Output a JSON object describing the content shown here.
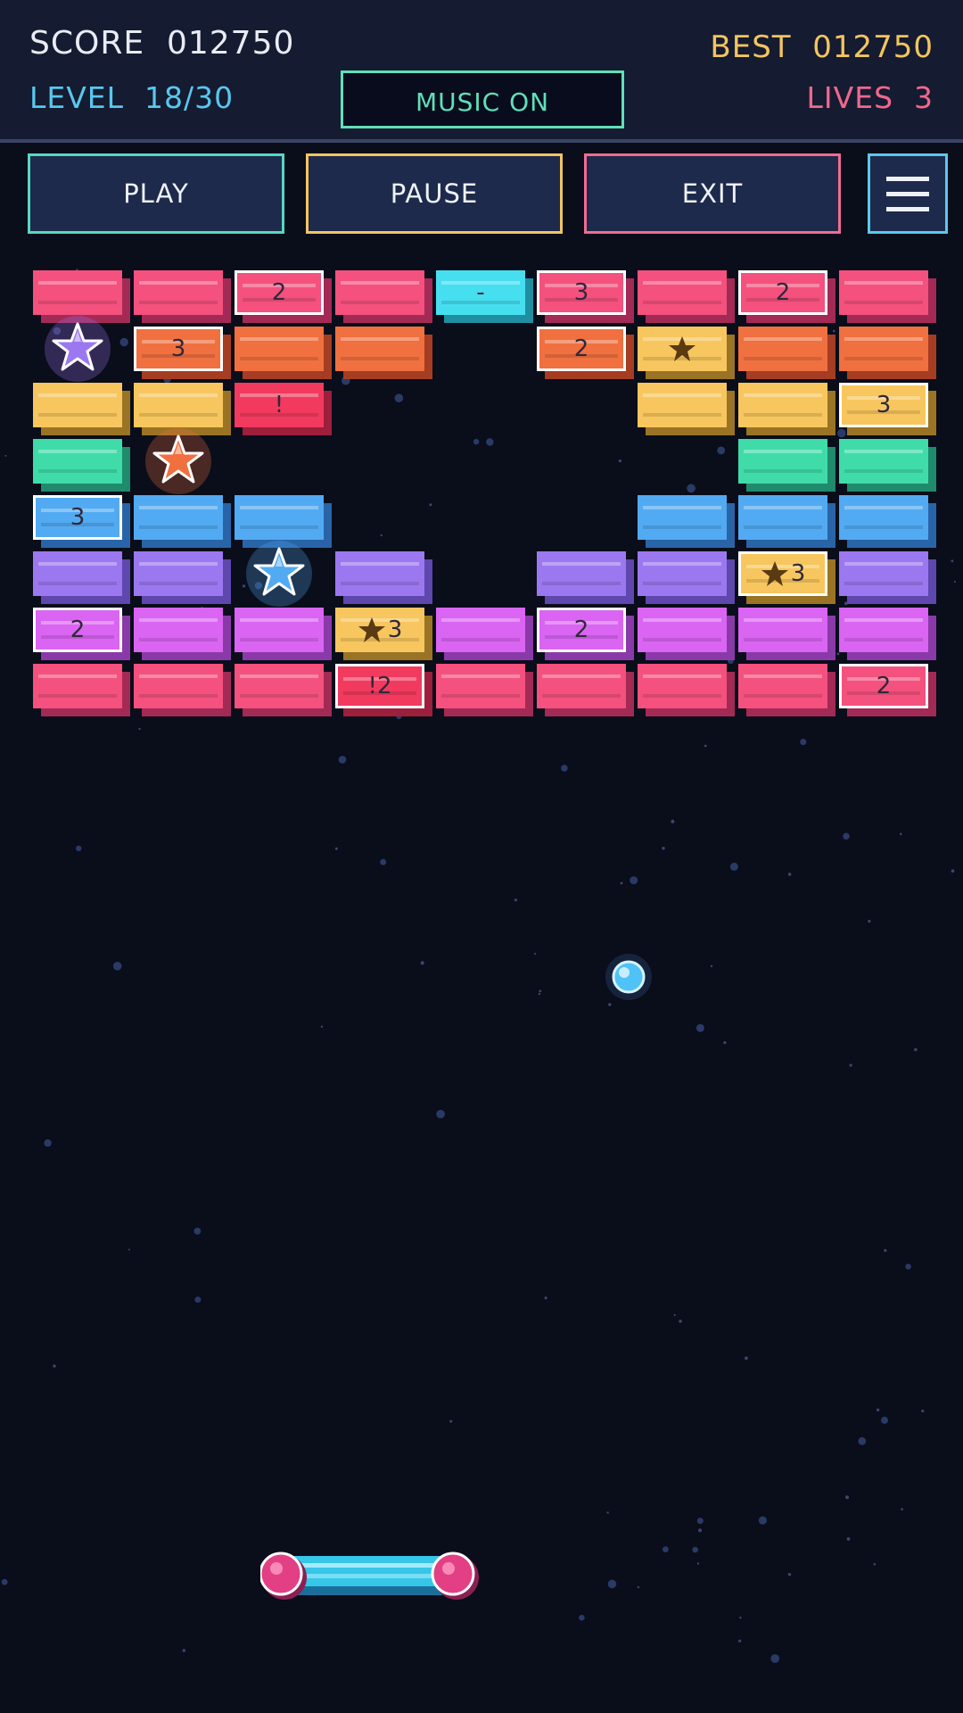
{
  "hud": {
    "score_label": "SCORE  012750",
    "best_label": "BEST  012750",
    "level_label": "LEVEL  18/30",
    "lives_label": "LIVES  3",
    "music_label": "MUSIC  ON"
  },
  "buttons": {
    "play": "PLAY",
    "pause": "PAUSE",
    "exit": "EXIT",
    "menu_icon": "hamburger-menu-icon"
  },
  "palette": {
    "pink": [
      "#f4517e",
      "#a32a55"
    ],
    "orange": [
      "#f07040",
      "#a43d22"
    ],
    "yellow": [
      "#f7c65e",
      "#9a7424"
    ],
    "green": [
      "#3fdca9",
      "#1f8a6c"
    ],
    "blue": [
      "#52aaf2",
      "#2a64a8"
    ],
    "violet": [
      "#9b78f0",
      "#5e47ad"
    ],
    "magenta": [
      "#d965f2",
      "#8a3aa8"
    ],
    "red": [
      "#f23a5e",
      "#9d1f3c"
    ],
    "cyan": [
      "#46dff0",
      "#1f8ea0"
    ]
  },
  "bricks": {
    "rows": [
      [
        {
          "c": "pink"
        },
        {
          "c": "pink"
        },
        {
          "c": "pink",
          "t": "2",
          "h": true
        },
        {
          "c": "pink"
        },
        {
          "c": "cyan",
          "t": "-"
        },
        {
          "c": "pink",
          "t": "3",
          "h": true
        },
        {
          "c": "pink"
        },
        {
          "c": "pink",
          "t": "2",
          "h": true
        },
        {
          "c": "pink"
        }
      ],
      [
        null,
        {
          "c": "orange",
          "t": "3",
          "h": true
        },
        {
          "c": "orange"
        },
        {
          "c": "orange"
        },
        null,
        {
          "c": "orange",
          "t": "2",
          "h": true
        },
        {
          "c": "yellow",
          "star": true
        },
        {
          "c": "orange"
        },
        {
          "c": "orange"
        }
      ],
      [
        {
          "c": "yellow"
        },
        {
          "c": "yellow"
        },
        {
          "c": "red",
          "t": "!"
        },
        null,
        null,
        null,
        {
          "c": "yellow"
        },
        {
          "c": "yellow"
        },
        {
          "c": "yellow",
          "t": "3",
          "h": true
        }
      ],
      [
        {
          "c": "green"
        },
        null,
        null,
        null,
        null,
        null,
        null,
        {
          "c": "green"
        },
        {
          "c": "green"
        }
      ],
      [
        {
          "c": "blue",
          "t": "3",
          "h": true
        },
        {
          "c": "blue"
        },
        {
          "c": "blue"
        },
        null,
        null,
        null,
        {
          "c": "blue"
        },
        {
          "c": "blue"
        },
        {
          "c": "blue"
        }
      ],
      [
        {
          "c": "violet"
        },
        {
          "c": "violet"
        },
        null,
        {
          "c": "violet"
        },
        null,
        {
          "c": "violet"
        },
        {
          "c": "violet"
        },
        {
          "c": "yellow",
          "t": "3",
          "star": true,
          "h": true
        },
        {
          "c": "violet"
        }
      ],
      [
        {
          "c": "magenta",
          "t": "2",
          "h": true
        },
        {
          "c": "magenta"
        },
        {
          "c": "magenta"
        },
        {
          "c": "yellow",
          "t": "3",
          "star": true
        },
        {
          "c": "magenta"
        },
        {
          "c": "magenta",
          "t": "2",
          "h": true
        },
        {
          "c": "magenta"
        },
        {
          "c": "magenta"
        },
        {
          "c": "magenta"
        }
      ],
      [
        {
          "c": "pink"
        },
        {
          "c": "pink"
        },
        {
          "c": "pink"
        },
        {
          "c": "red",
          "t": "!2",
          "h": true
        },
        {
          "c": "pink"
        },
        {
          "c": "pink"
        },
        {
          "c": "pink"
        },
        {
          "c": "pink"
        },
        {
          "c": "pink",
          "t": "2",
          "h": true
        }
      ]
    ]
  },
  "powerups": [
    {
      "row": 1,
      "col": 0,
      "color": "#9b78f0",
      "name": "purple-star-powerup"
    },
    {
      "row": 3,
      "col": 1,
      "color": "#f07040",
      "name": "orange-star-powerup"
    },
    {
      "row": 5,
      "col": 2,
      "color": "#52aaf2",
      "name": "blue-star-powerup"
    }
  ],
  "ball_color": "#4fc3f7",
  "paddle_colors": {
    "bar": "#36c6e8",
    "caps": "#e23f84"
  }
}
